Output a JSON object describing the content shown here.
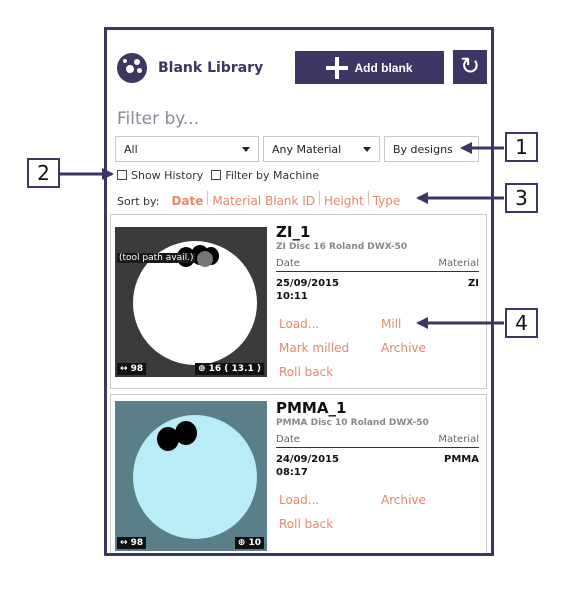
{
  "app": {
    "title": "Blank Library",
    "add_button": "Add blank",
    "refresh_icon": "refresh-icon",
    "logo_icon": "blank-library-logo-icon"
  },
  "filter": {
    "label": "Filter by...",
    "dropdowns": [
      {
        "value": "All",
        "has_caret": true
      },
      {
        "value": "Any Material",
        "has_caret": true
      },
      {
        "value": "By designs",
        "has_caret": false
      }
    ],
    "checkboxes": [
      {
        "label": "Show History",
        "checked": false
      },
      {
        "label": "Filter by Machine",
        "checked": false
      }
    ]
  },
  "sort": {
    "label": "Sort by:",
    "options": [
      "Date",
      "Material Blank ID",
      "Height",
      "Type"
    ],
    "active": "Date"
  },
  "blanks": [
    {
      "name": "ZI_1",
      "subtitle": "ZI Disc 16 Roland DWX-50",
      "date_header": "Date",
      "material_header": "Material",
      "date": "25/09/2015 10:11",
      "material": "ZI",
      "toolpath_label": "(tool path avail.)",
      "diameter": "↔ 98",
      "height": "⊕ 16 ( 13.1 )",
      "actions": [
        "Load...",
        "Mill",
        "Mark milled",
        "Archive",
        "Roll back"
      ],
      "disc_color": "#ffffff",
      "bg_color": "#3b3b3b"
    },
    {
      "name": "PMMA_1",
      "subtitle": "PMMA Disc 10 Roland DWX-50",
      "date_header": "Date",
      "material_header": "Material",
      "date": "24/09/2015 08:17",
      "material": "PMMA",
      "diameter": "↔ 98",
      "height": "⊕ 10",
      "actions": [
        "Load...",
        "Archive",
        "Roll back"
      ],
      "disc_color": "#b8ecf7",
      "bg_color": "#5a7f88"
    }
  ],
  "callouts": [
    "1",
    "2",
    "3",
    "4"
  ],
  "colors": {
    "accent": "#3d3663",
    "link": "#e8866a"
  }
}
